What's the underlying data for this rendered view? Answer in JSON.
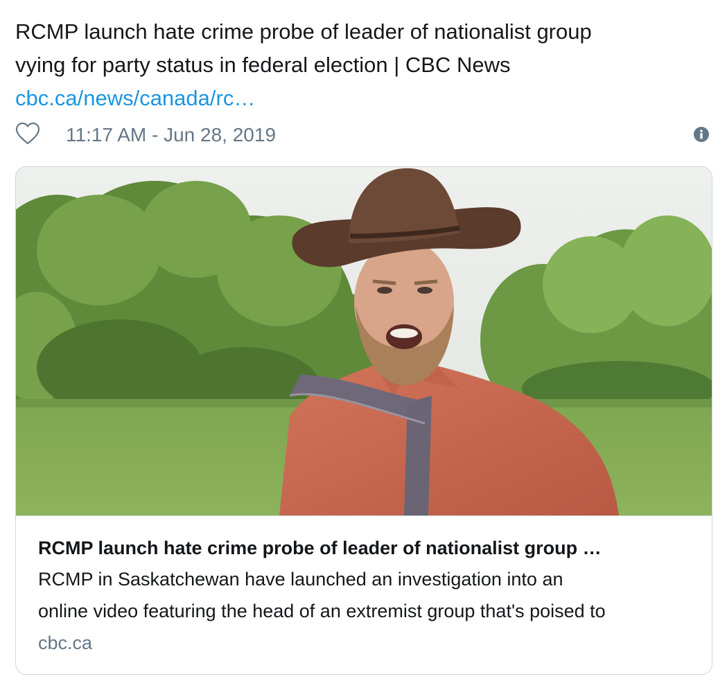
{
  "tweet": {
    "text_line1": "RCMP launch hate crime probe of leader of nationalist group",
    "text_line2": "vying for party status in federal election | CBC News",
    "link_text": "cbc.ca/news/canada/rc…",
    "timestamp": "11:17 AM - Jun 28, 2019",
    "icons": {
      "like": "heart-icon",
      "info": "info-icon"
    }
  },
  "card": {
    "image_description": "man-in-cowboy-hat-photo",
    "title": "RCMP launch hate crime probe of leader of nationalist group …",
    "description_line1": "RCMP in Saskatchewan have launched an investigation into an",
    "description_line2": "online video featuring the head of an extremist group that's poised to",
    "domain": "cbc.ca"
  },
  "colors": {
    "link": "#1b95e0",
    "muted": "#657786",
    "text": "#14171a",
    "border": "#ccd6dd"
  }
}
